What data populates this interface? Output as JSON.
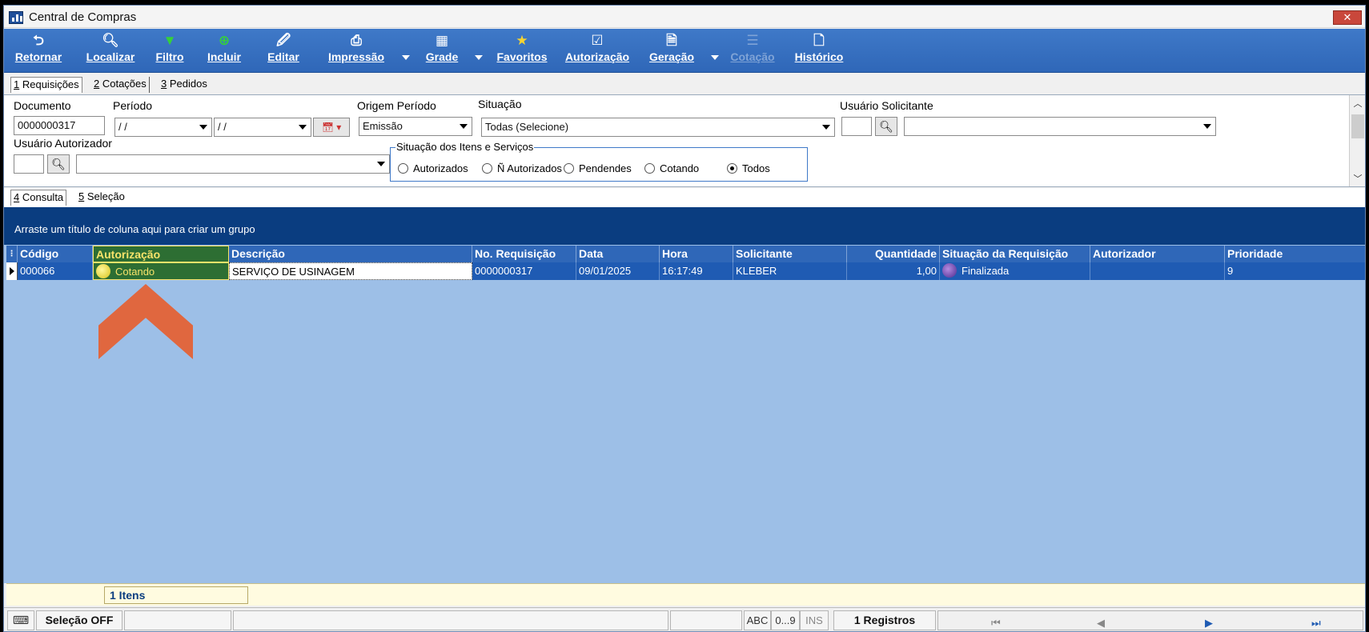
{
  "window": {
    "title": "Central de Compras",
    "close": "✕"
  },
  "toolbar": {
    "retornar": "Retornar",
    "localizar": "Localizar",
    "filtro": "Filtro",
    "incluir": "Incluir",
    "editar": "Editar",
    "impressao": "Impressão",
    "grade": "Grade",
    "favoritos": "Favoritos",
    "autorizacao": "Autorização",
    "geracao": "Geração",
    "cotacao": "Cotação",
    "historico": "Histórico"
  },
  "tabs": [
    {
      "key": "1",
      "label": " Requisições"
    },
    {
      "key": "2",
      "label": " Cotações"
    },
    {
      "key": "3",
      "label": " Pedidos"
    }
  ],
  "filters": {
    "documento_label": "Documento",
    "documento_value": "0000000317",
    "periodo_label": "Período",
    "periodo_from": " / /",
    "periodo_to": " / /",
    "origem_label": "Origem Período",
    "origem_value": "Emissão",
    "situacao_label": "Situação",
    "situacao_value": "Todas (Selecione)",
    "usuario_solicitante_label": "Usuário Solicitante",
    "usuario_autorizador_label": "Usuário Autorizador",
    "itens_group_label": "Situação dos Itens e Serviços",
    "radios": [
      "Autorizados",
      "Ñ Autorizados",
      "Pendendes",
      "Cotando",
      "Todos"
    ],
    "radio_selected": "Todos"
  },
  "subtabs": [
    {
      "key": "4",
      "label": " Consulta"
    },
    {
      "key": "5",
      "label": " Seleção"
    }
  ],
  "grid": {
    "group_hint": "Arraste um título de coluna aqui para criar um grupo",
    "columns": [
      "Código",
      "Autorização",
      "Descrição",
      "No. Requisição",
      "Data",
      "Hora",
      "Solicitante",
      "Quantidade",
      "Situação da Requisição",
      "Autorizador",
      "Prioridade"
    ],
    "rows": [
      {
        "codigo": "000066",
        "autorizacao": "Cotando",
        "descricao": "SERVIÇO DE USINAGEM",
        "requisicao": "0000000317",
        "data": "09/01/2025",
        "hora": "16:17:49",
        "solicitante": "KLEBER",
        "quantidade": "1,00",
        "situacao": "Finalizada",
        "autorizador": "",
        "prioridade": "9"
      }
    ],
    "footer_count": "1 Itens"
  },
  "statusbar": {
    "selecao": "Seleção OFF",
    "abc": "ABC",
    "num": "0...9",
    "ins": "INS",
    "registros": "1 Registros"
  },
  "colors": {
    "toolbar": "#2f67b8",
    "group_panel": "#0a3d80",
    "grid_bg": "#9dbfe7",
    "highlight": "#f8e36a",
    "arrow": "#e0673f"
  }
}
